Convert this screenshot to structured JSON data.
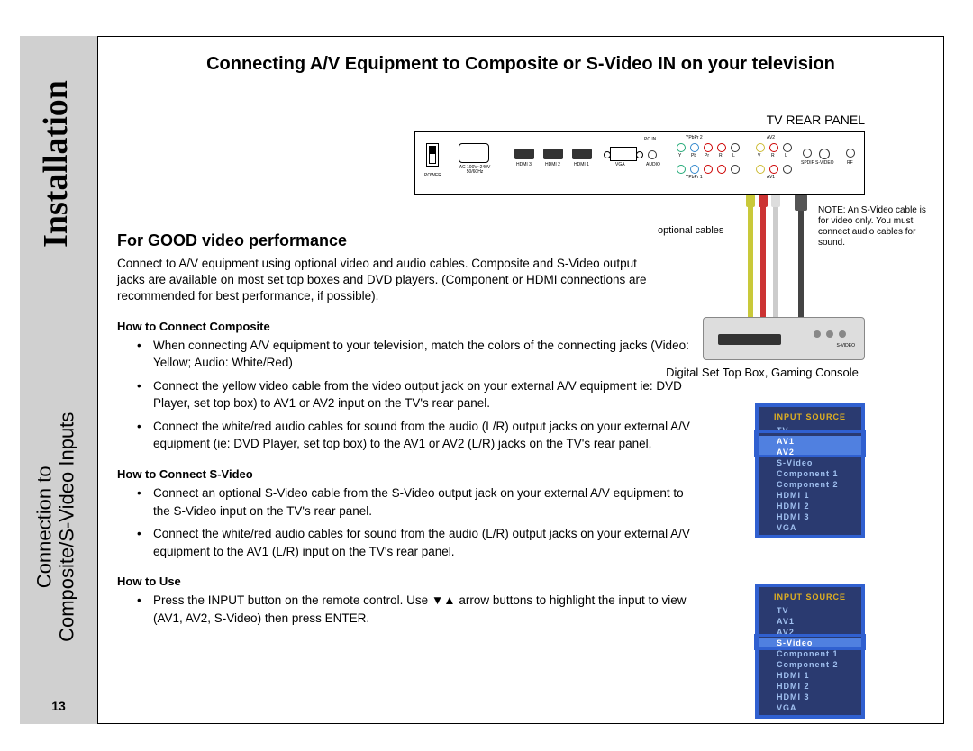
{
  "sidebar": {
    "chapter": "Installation",
    "section_line1": "Connection to",
    "section_line2": "Composite/S-Video Inputs",
    "page_number": "13"
  },
  "title": "Connecting A/V Equipment to Composite or S-Video IN on your television",
  "panel_label": "TV REAR PANEL",
  "rear_panel": {
    "power": "POWER",
    "ac": "AC 100V~240V 50/60Hz",
    "hdmi3": "HDMI 3",
    "hdmi2": "HDMI 2",
    "hdmi1": "HDMI 1",
    "vga": "VGA",
    "audio": "AUDIO",
    "pcin": "PC IN",
    "ypbpr1": "YPbPr 1",
    "ypbpr2": "YPbPr 2",
    "av1": "AV1",
    "av2": "AV2",
    "spdif": "SPDIF",
    "svideo": "S-VIDEO",
    "rf": "RF",
    "y": "Y",
    "pb": "Pb",
    "pr": "Pr",
    "r": "R",
    "l": "L",
    "v": "V"
  },
  "subtitle": "For GOOD video performance",
  "intro": "Connect to A/V equipment using optional video and audio cables. Composite and S-Video output jacks are available on most set top boxes and DVD players. (Component or HDMI connections are recommended for best performance, if possible).",
  "optional_cables": "optional cables",
  "note": "NOTE: An S-Video cable is for video only. You must connect audio cables for sound.",
  "stb_caption": "Digital Set Top Box, Gaming Console",
  "sections": [
    {
      "head": "How to Connect Composite",
      "items": [
        "When connecting A/V equipment to your television, match the colors of the connecting jacks (Video: Yellow; Audio: White/Red)",
        "Connect the yellow video cable from the video output jack on your external A/V equipment ie: DVD Player, set top box) to AV1 or AV2 input on the TV's rear panel.",
        "Connect the white/red audio cables for sound from the audio (L/R) output jacks on your external A/V equipment (ie: DVD Player, set top box) to the AV1 or AV2 (L/R) jacks on the TV's rear panel."
      ]
    },
    {
      "head": "How to Connect S-Video",
      "items": [
        "Connect an optional S-Video cable from the S-Video output jack on your external A/V equipment to the S-Video input on the TV's rear panel.",
        "Connect the white/red audio cables for sound from the audio (L/R) output jacks on your external A/V equipment to the AV1 (L/R) input on the TV's rear panel."
      ]
    },
    {
      "head": "How to Use",
      "items": [
        "Press the INPUT button on the remote control. Use ▼▲ arrow buttons to highlight the input to view (AV1, AV2, S-Video) then press ENTER."
      ]
    }
  ],
  "menu": {
    "header": "INPUT SOURCE",
    "items": [
      "TV",
      "AV1",
      "AV2",
      "S-Video",
      "Component 1",
      "Component 2",
      "HDMI 1",
      "HDMI 2",
      "HDMI 3",
      "VGA"
    ],
    "menu1_selected": [
      1,
      2
    ],
    "menu2_selected": [
      3
    ]
  }
}
